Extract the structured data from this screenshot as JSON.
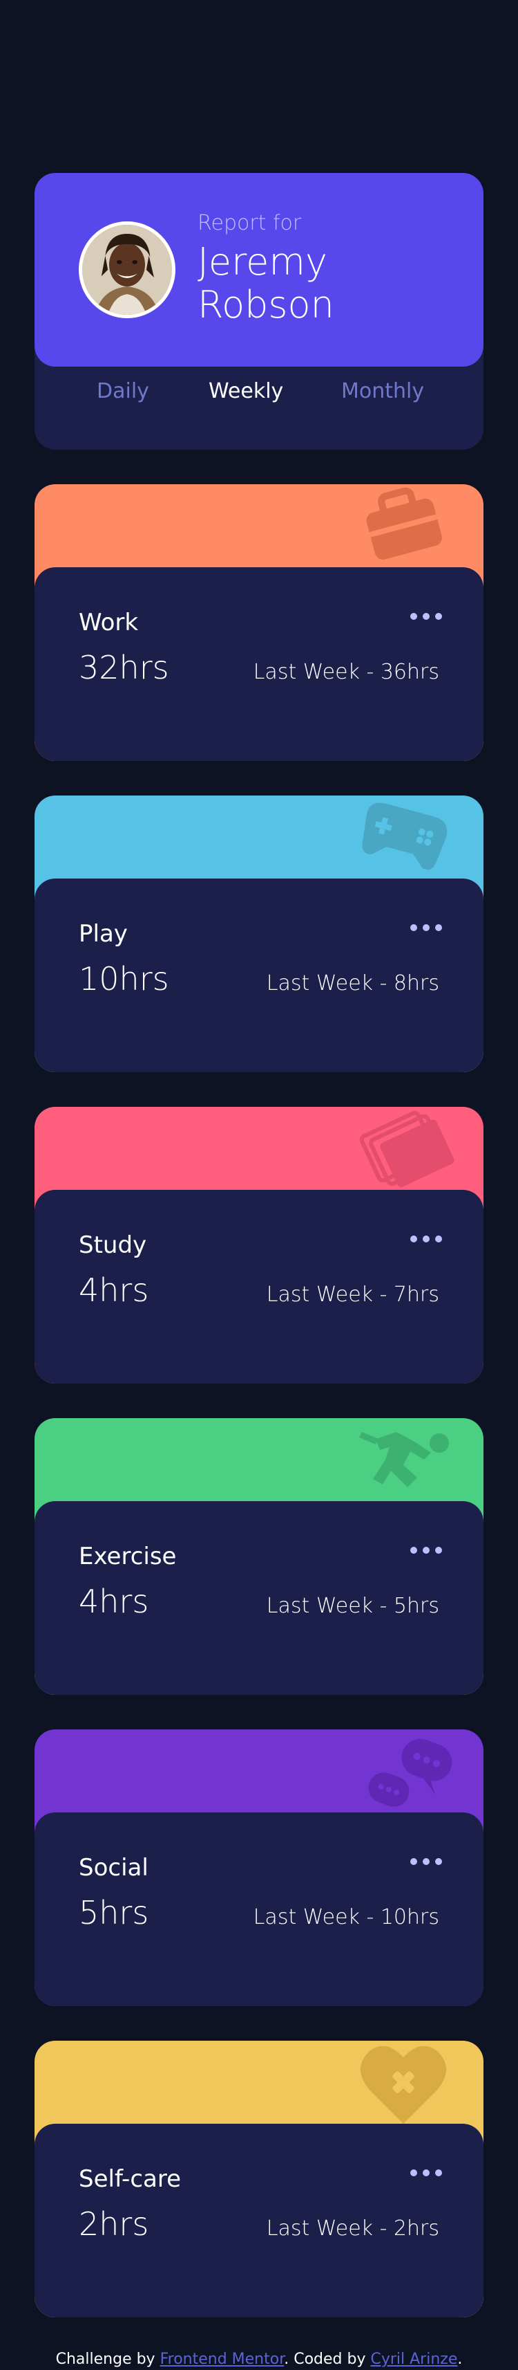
{
  "profile": {
    "report_for": "Report for",
    "name_line1": "Jeremy",
    "name_line2": "Robson",
    "avatar_alt": "Jeremy Robson avatar"
  },
  "tabs": [
    {
      "label": "Daily",
      "active": false
    },
    {
      "label": "Weekly",
      "active": true
    },
    {
      "label": "Monthly",
      "active": false
    }
  ],
  "cards": [
    {
      "title": "Work",
      "hours": "32hrs",
      "last": "Last Week - 36hrs",
      "color": "#ff8b64",
      "icon": "briefcase-icon"
    },
    {
      "title": "Play",
      "hours": "10hrs",
      "last": "Last Week - 8hrs",
      "color": "#55c2e6",
      "icon": "gamepad-icon"
    },
    {
      "title": "Study",
      "hours": "4hrs",
      "last": "Last Week - 7hrs",
      "color": "#ff5e7d",
      "icon": "book-icon"
    },
    {
      "title": "Exercise",
      "hours": "4hrs",
      "last": "Last Week - 5hrs",
      "color": "#4bcf82",
      "icon": "runner-icon"
    },
    {
      "title": "Social",
      "hours": "5hrs",
      "last": "Last Week - 10hrs",
      "color": "#7335d2",
      "icon": "chat-bubbles-icon"
    },
    {
      "title": "Self-care",
      "hours": "2hrs",
      "last": "Last Week - 2hrs",
      "color": "#f1c75b",
      "icon": "heart-icon"
    }
  ],
  "footer": {
    "prefix": "Challenge by ",
    "link1": "Frontend Mentor",
    "middle": ". Coded by ",
    "link2": "Cyril Arinze",
    "suffix": "."
  },
  "colors": {
    "background": "#0e1323",
    "card_body": "#1c1f4a",
    "profile_accent": "#5847eb",
    "tab_inactive": "#7078c9"
  }
}
